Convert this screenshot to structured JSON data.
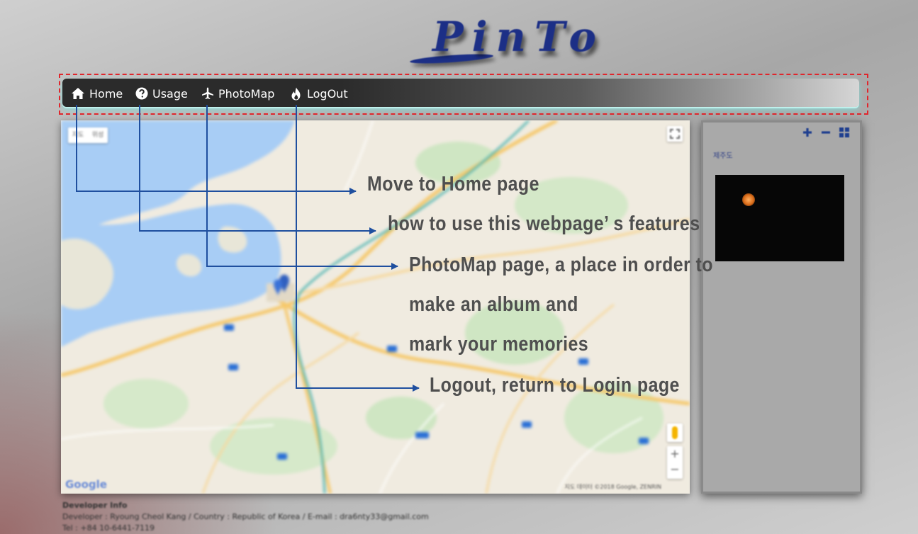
{
  "app": {
    "logo_text": "PinTo"
  },
  "nav": {
    "items": [
      {
        "label": "Home",
        "icon": "home-icon"
      },
      {
        "label": "Usage",
        "icon": "question-circle-icon"
      },
      {
        "label": "PhotoMap",
        "icon": "plane-icon"
      },
      {
        "label": "LogOut",
        "icon": "fire-icon"
      }
    ]
  },
  "map": {
    "type_buttons": [
      "지도",
      "위성"
    ],
    "google_label": "Google",
    "copyright": "지도 데이터 ©2018 Google, ZENRIN"
  },
  "panel": {
    "album_label": "제주도",
    "tool_icons": [
      "plus-icon",
      "minus-icon",
      "grid-icon"
    ]
  },
  "annotations": {
    "home": "Move to Home page",
    "usage": "how to use this webpage’ s features",
    "photomap_line1": "PhotoMap page, a place in order to",
    "photomap_line2": "make an album and",
    "photomap_line3": "mark your memories",
    "logout": "Logout, return to Login page"
  },
  "footer": {
    "title": "Developer Info",
    "line1": "Developer : Ryoung Cheol Kang / Country : Republic of Korea / E-mail : dra6nty33@gmail.com",
    "line2": "Tel : +84 10-6441-7119"
  },
  "colors": {
    "arrow": "#1f4f9f",
    "highlight_border": "#e0262c",
    "annotation_text": "#4f4f4f",
    "logo": "#1c2f86"
  }
}
